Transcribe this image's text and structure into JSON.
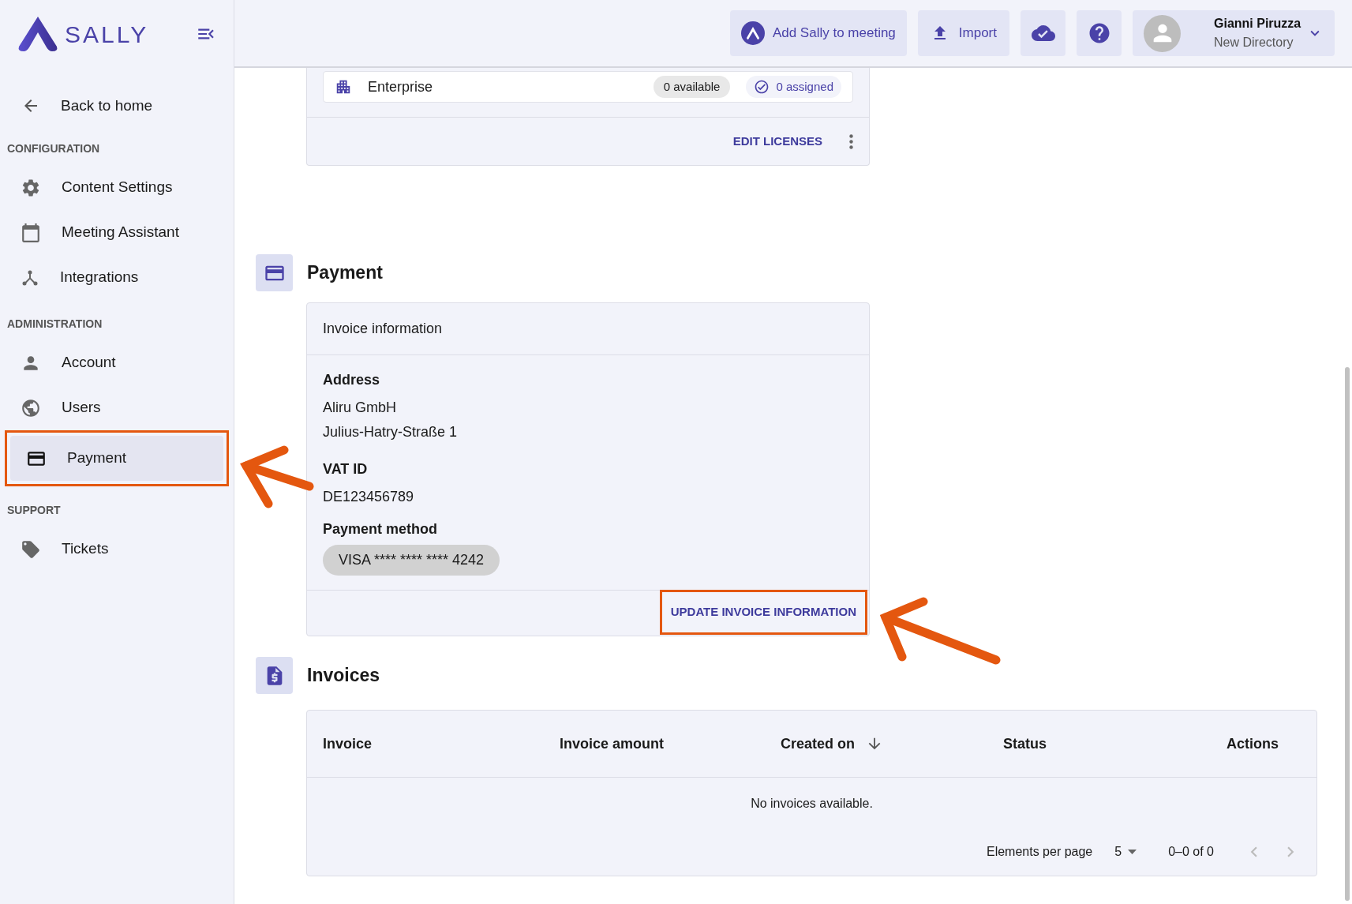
{
  "sidebar": {
    "logo": "SALLY",
    "back": "Back to home",
    "sections": [
      {
        "title": "CONFIGURATION",
        "items": [
          {
            "label": "Content Settings",
            "selected": false
          },
          {
            "label": "Meeting Assistant",
            "selected": false
          },
          {
            "label": "Integrations",
            "selected": false
          }
        ]
      },
      {
        "title": "ADMINISTRATION",
        "items": [
          {
            "label": "Account",
            "selected": false
          },
          {
            "label": "Users",
            "selected": false
          },
          {
            "label": "Payment",
            "selected": true
          }
        ]
      },
      {
        "title": "SUPPORT",
        "items": [
          {
            "label": "Tickets",
            "selected": false
          }
        ]
      }
    ]
  },
  "header": {
    "add_button": "Add Sally to meeting",
    "import_button": "Import",
    "user": {
      "name": "Gianni Piruzza",
      "directory": "New Directory"
    }
  },
  "licenses": {
    "plan": "Enterprise",
    "available": "0 available",
    "assigned": "0 assigned",
    "edit_button": "EDIT LICENSES"
  },
  "payment": {
    "title": "Payment",
    "card_title": "Invoice information",
    "address_label": "Address",
    "address_lines": [
      "Aliru GmbH",
      "Julius-Hatry-Straße 1"
    ],
    "vat_label": "VAT ID",
    "vat": "DE123456789",
    "method_label": "Payment method",
    "method": "VISA **** **** **** 4242",
    "update_button": "UPDATE INVOICE INFORMATION"
  },
  "invoices": {
    "title": "Invoices",
    "columns": [
      "Invoice",
      "Invoice amount",
      "Created on",
      "Status",
      "Actions"
    ],
    "empty": "No invoices available.",
    "per_page_label": "Elements per page",
    "per_page": "5",
    "range": "0–0 of 0"
  }
}
